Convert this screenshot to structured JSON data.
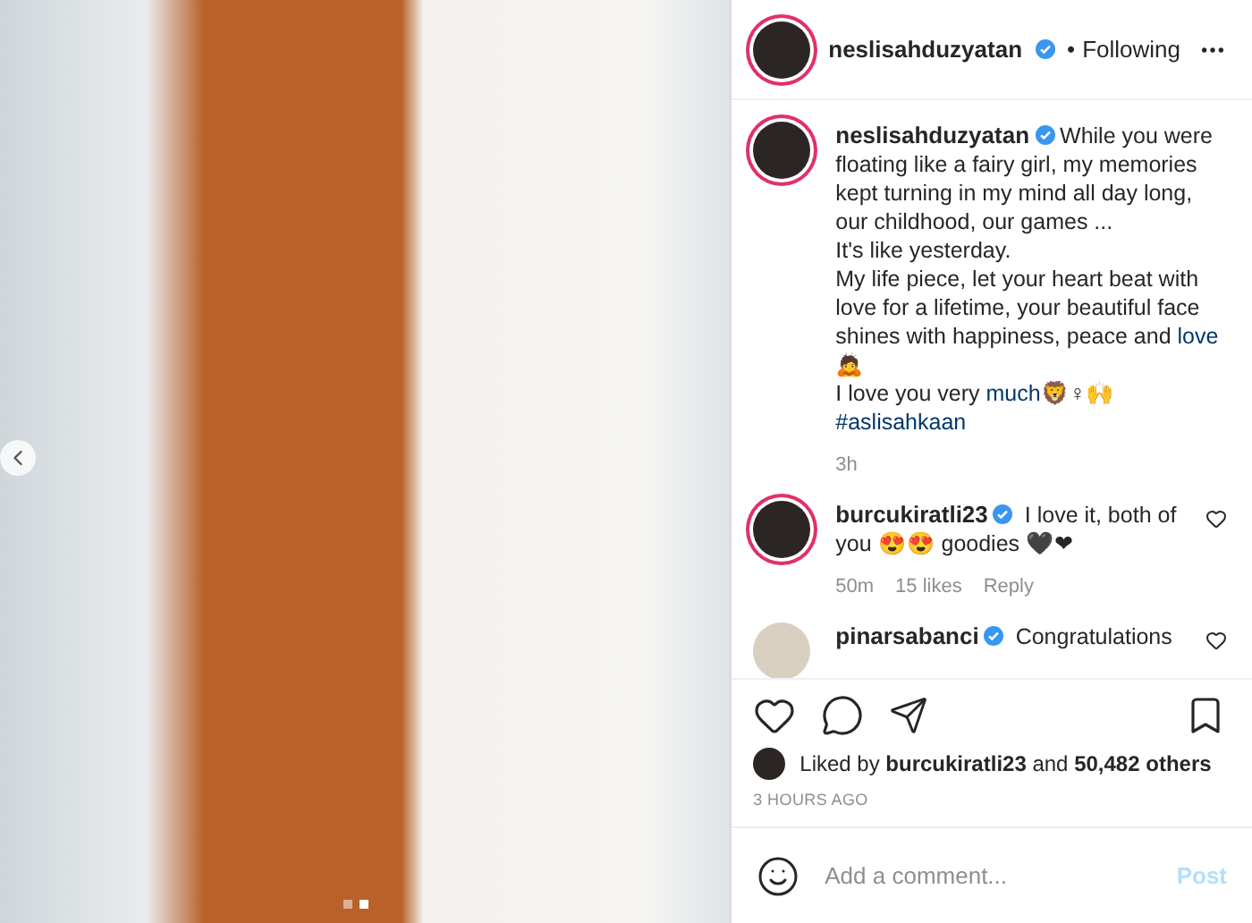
{
  "photo": {
    "dots": [
      {
        "selected": false
      },
      {
        "selected": true
      }
    ]
  },
  "header": {
    "username": "neslisahduzyatan",
    "verified": true,
    "separator": "•",
    "follow": "Following"
  },
  "caption": {
    "username": "neslisahduzyatan",
    "verified": true,
    "segments": [
      {
        "kind": "text",
        "text": "While you were floating like a fairy girl, my memories kept turning in my mind all day long, our childhood, our games ...\nIt's like yesterday.\nMy life piece, let your heart beat with love for a lifetime, your beautiful face shines with happiness, peace and "
      },
      {
        "kind": "link",
        "text": "love"
      },
      {
        "kind": "text",
        "text": "\n🙇\nI love you very "
      },
      {
        "kind": "link",
        "text": "much"
      },
      {
        "kind": "text",
        "text": "🦁♀🙌\n"
      },
      {
        "kind": "link",
        "text": "#aslisahkaan"
      }
    ],
    "time": "3h"
  },
  "comments": [
    {
      "username": "burcukiratli23",
      "verified": true,
      "text": "I love it, both of you 😍😍 goodies 🖤❤",
      "time": "50m",
      "likes": "15 likes",
      "reply": "Reply",
      "ring": true
    },
    {
      "username": "pinarsabanci",
      "verified": true,
      "text": "Congratulations",
      "ring": false
    }
  ],
  "liked": "Liked by **burcukiratli23** and **50,482 others**",
  "timestamp": "3 HOURS AGO",
  "comment_field": {
    "placeholder": "Add a comment...",
    "post": "Post"
  }
}
